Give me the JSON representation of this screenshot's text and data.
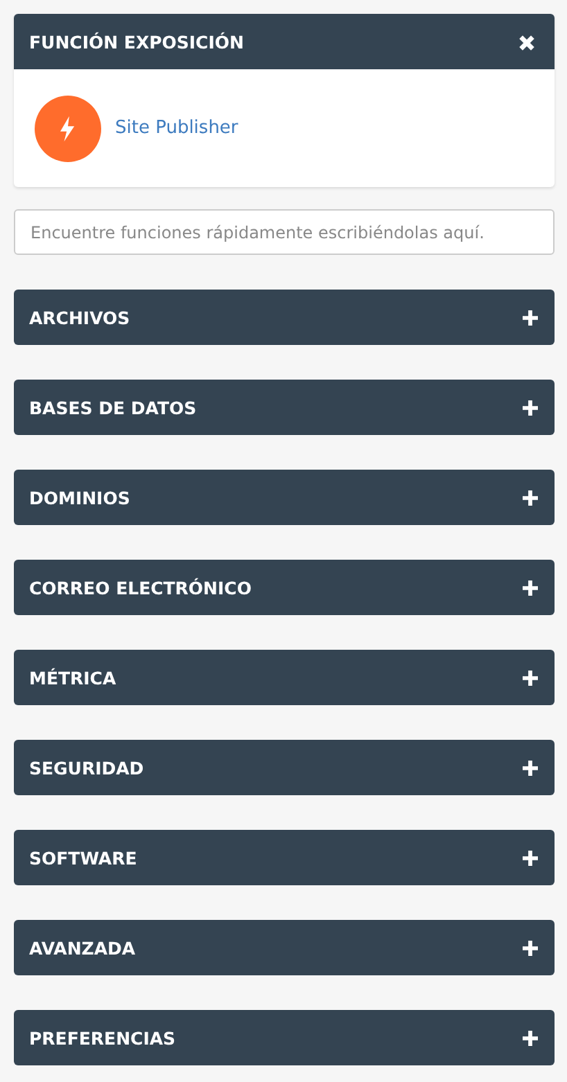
{
  "featured": {
    "title": "FUNCIÓN EXPOSICIÓN",
    "items": [
      {
        "label": "Site Publisher"
      }
    ]
  },
  "search": {
    "placeholder": "Encuentre funciones rápidamente escribiéndolas aquí."
  },
  "sections": [
    {
      "title": "ARCHIVOS",
      "expanded": false
    },
    {
      "title": "BASES DE DATOS",
      "expanded": false
    },
    {
      "title": "DOMINIOS",
      "expanded": false
    },
    {
      "title": "CORREO ELECTRÓNICO",
      "expanded": false
    },
    {
      "title": "MÉTRICA",
      "expanded": false
    },
    {
      "title": "SEGURIDAD",
      "expanded": false
    },
    {
      "title": "SOFTWARE",
      "expanded": false
    },
    {
      "title": "AVANZADA",
      "expanded": false
    },
    {
      "title": "PREFERENCIAS",
      "expanded": false
    }
  ]
}
